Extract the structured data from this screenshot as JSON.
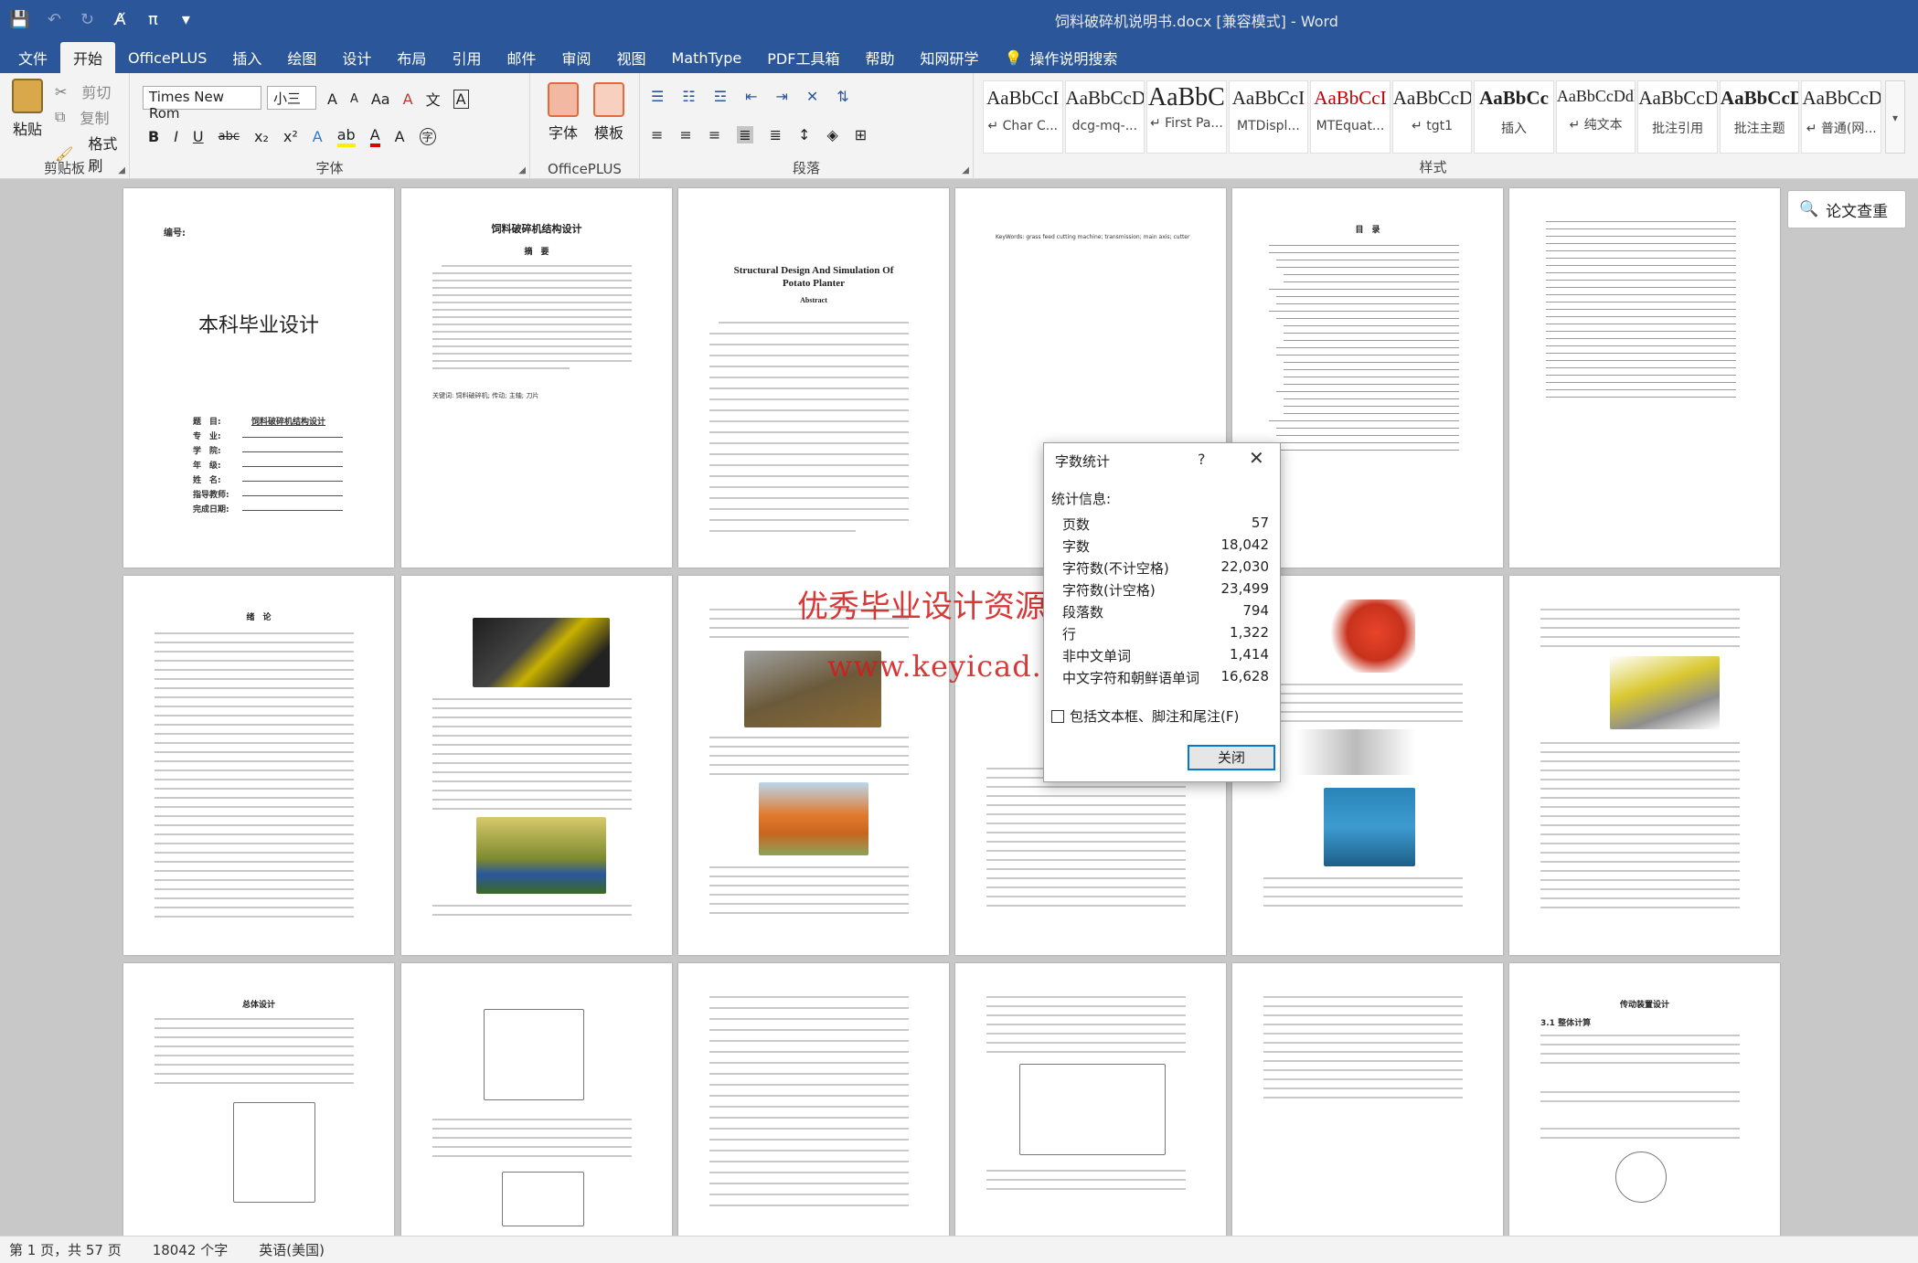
{
  "window": {
    "title": "饲料破碎机说明书.docx [兼容模式] - Word"
  },
  "qat": {
    "save": "💾",
    "undo": "↶",
    "redo": "↻",
    "format_painter": "A̸",
    "pi": "π",
    "more": "▾"
  },
  "tabs": [
    "文件",
    "开始",
    "OfficePLUS",
    "插入",
    "绘图",
    "设计",
    "布局",
    "引用",
    "邮件",
    "审阅",
    "视图",
    "MathType",
    "PDF工具箱",
    "帮助",
    "知网研学"
  ],
  "active_tab": "开始",
  "search": {
    "label": "操作说明搜索",
    "icon": "lightbulb-icon"
  },
  "ribbon": {
    "clipboard": {
      "label": "剪贴板",
      "paste": "粘贴",
      "cut": "剪切",
      "copy": "复制",
      "format_painter": "格式刷"
    },
    "font": {
      "label": "字体",
      "font_name": "Times New Rom",
      "font_size": "小三",
      "grow": "A",
      "shrink": "A",
      "case": "Aa",
      "clear": "A",
      "phonetic": "文",
      "border": "A",
      "bold": "B",
      "italic": "I",
      "underline": "U",
      "strike": "abc",
      "sub": "x₂",
      "sup": "x²",
      "effects": "A",
      "highlight": "ab",
      "color": "A",
      "charshade": "A",
      "enclose": "字"
    },
    "officeplus": {
      "label": "OfficePLUS",
      "font_btn": "字体",
      "template_btn": "模板"
    },
    "paragraph": {
      "label": "段落"
    },
    "styles": {
      "label": "样式",
      "items": [
        {
          "preview": "AaBbCcI",
          "name": "↵ Char C..."
        },
        {
          "preview": "AaBbCcD",
          "name": "dcg-mq-..."
        },
        {
          "preview": "AaBbC",
          "name": "↵ First Pa..."
        },
        {
          "preview": "AaBbCcI",
          "name": "MTDispl..."
        },
        {
          "preview": "AaBbCcI",
          "name": "MTEquat..."
        },
        {
          "preview": "AaBbCcDc",
          "name": "↵ tgt1"
        },
        {
          "preview": "AaBbCc",
          "name": "插入"
        },
        {
          "preview": "AaBbCcDdl",
          "name": "↵ 纯文本"
        },
        {
          "preview": "AaBbCcD",
          "name": "批注引用"
        },
        {
          "preview": "AaBbCcD",
          "name": "批注主题"
        },
        {
          "preview": "AaBbCcDc",
          "name": "↵ 普通(网..."
        }
      ],
      "preview_colors": [
        "#222222",
        "#222222",
        "#222222",
        "#222222",
        "#c00000",
        "#222222",
        "#000000",
        "#222222",
        "#222222",
        "#000000",
        "#222222"
      ]
    }
  },
  "side_button": {
    "label": "论文查重",
    "icon": "document-search-icon"
  },
  "pages": {
    "p1": {
      "label": "编号:",
      "title": "本科毕业设计",
      "field_labels": [
        "题　目:",
        "专　业:",
        "学　院:",
        "年　级:",
        "姓　名:",
        "指导教师:",
        "完成日期:"
      ],
      "topic": "饲料破碎机结构设计"
    },
    "p2": {
      "title": "饲料破碎机结构设计",
      "subtitle": "摘　要",
      "keywords": "关键词: 饲料破碎机; 传动; 主轴; 刀片"
    },
    "p3": {
      "title": "Structural Design And Simulation Of",
      "title2": "Potato Planter",
      "subtitle": "Abstract"
    },
    "p4": {
      "keywords": "KeyWords: grass feed cutting machine; transmission; main axis; cutter"
    },
    "p5": {
      "title": "目　录"
    },
    "p7": {
      "title": "绪　论"
    },
    "p13": {
      "title": "总体设计"
    },
    "p18": {
      "title": "传动装置设计",
      "section": "3.1 整体计算"
    }
  },
  "dialog": {
    "title": "字数统计",
    "help": "?",
    "close_x": "✕",
    "subtitle": "统计信息:",
    "rows": [
      {
        "label": "页数",
        "value": "57"
      },
      {
        "label": "字数",
        "value": "18,042"
      },
      {
        "label": "字符数(不计空格)",
        "value": "22,030"
      },
      {
        "label": "字符数(计空格)",
        "value": "23,499"
      },
      {
        "label": "段落数",
        "value": "794"
      },
      {
        "label": "行",
        "value": "1,322"
      },
      {
        "label": "非中文单词",
        "value": "1,414"
      },
      {
        "label": "中文字符和朝鲜语单词",
        "value": "16,628"
      }
    ],
    "checkbox": "包括文本框、脚注和尾注(F)",
    "close_button": "关闭"
  },
  "watermark": {
    "line1": "优秀毕业设计资源网",
    "line2": "www.keyicad.cn"
  },
  "status": {
    "page": "第 1 页，共 57 页",
    "words": "18042 个字",
    "language": "英语(美国)"
  }
}
